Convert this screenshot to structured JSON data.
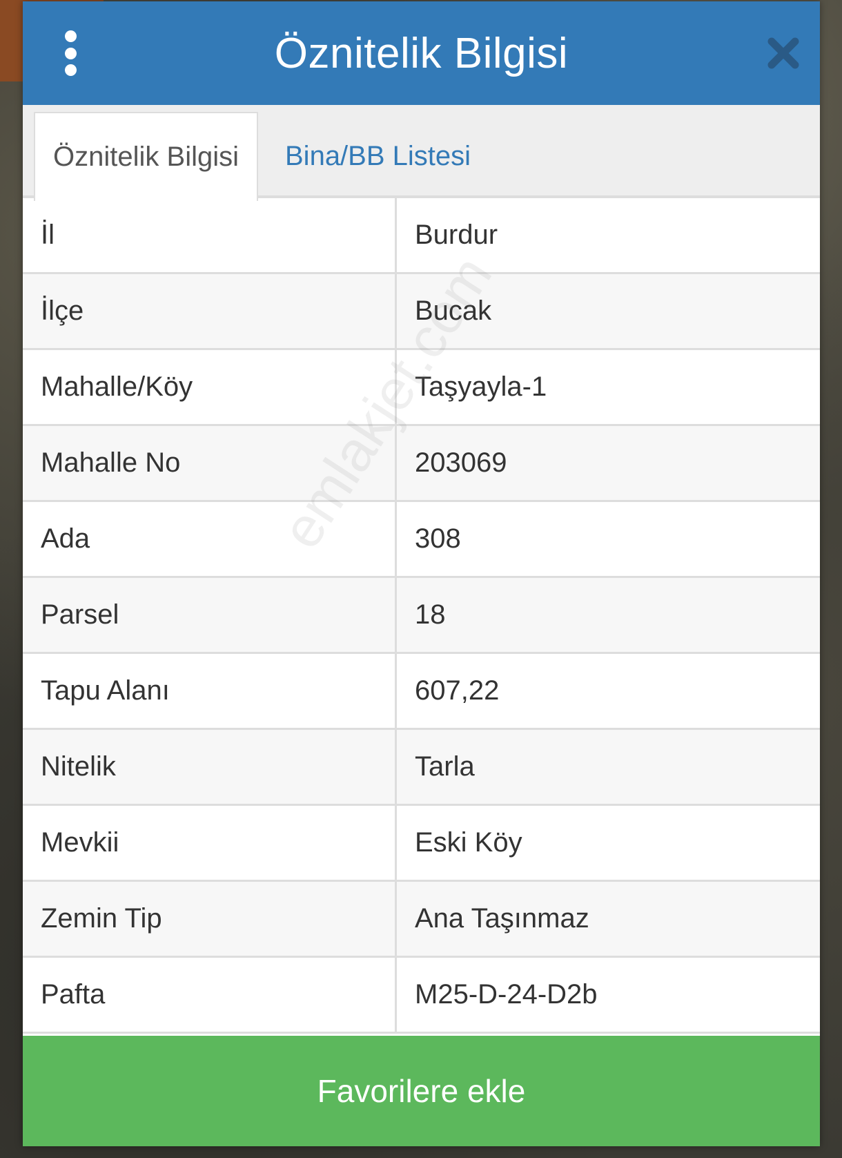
{
  "dialog": {
    "title": "Öznitelik Bilgisi",
    "menu_icon": "vertical-dots-icon",
    "close_icon": "close-icon"
  },
  "tabs": [
    {
      "label": "Öznitelik Bilgisi",
      "active": true
    },
    {
      "label": "Bina/BB Listesi",
      "active": false
    }
  ],
  "attributes": [
    {
      "key": "İl",
      "value": "Burdur"
    },
    {
      "key": "İlçe",
      "value": "Bucak"
    },
    {
      "key": "Mahalle/Köy",
      "value": "Taşyayla-1"
    },
    {
      "key": "Mahalle No",
      "value": "203069"
    },
    {
      "key": "Ada",
      "value": "308"
    },
    {
      "key": "Parsel",
      "value": "18"
    },
    {
      "key": "Tapu Alanı",
      "value": "607,22"
    },
    {
      "key": "Nitelik",
      "value": "Tarla"
    },
    {
      "key": "Mevkii",
      "value": "Eski Köy"
    },
    {
      "key": "Zemin Tip",
      "value": "Ana Taşınmaz"
    },
    {
      "key": "Pafta",
      "value": "M25-D-24-D2b"
    }
  ],
  "footer": {
    "add_favorites_label": "Favorilere ekle"
  },
  "watermark": "emlakjet.com",
  "colors": {
    "header": "#337ab7",
    "tab_link": "#337ab7",
    "footer_button": "#5cb85c"
  }
}
